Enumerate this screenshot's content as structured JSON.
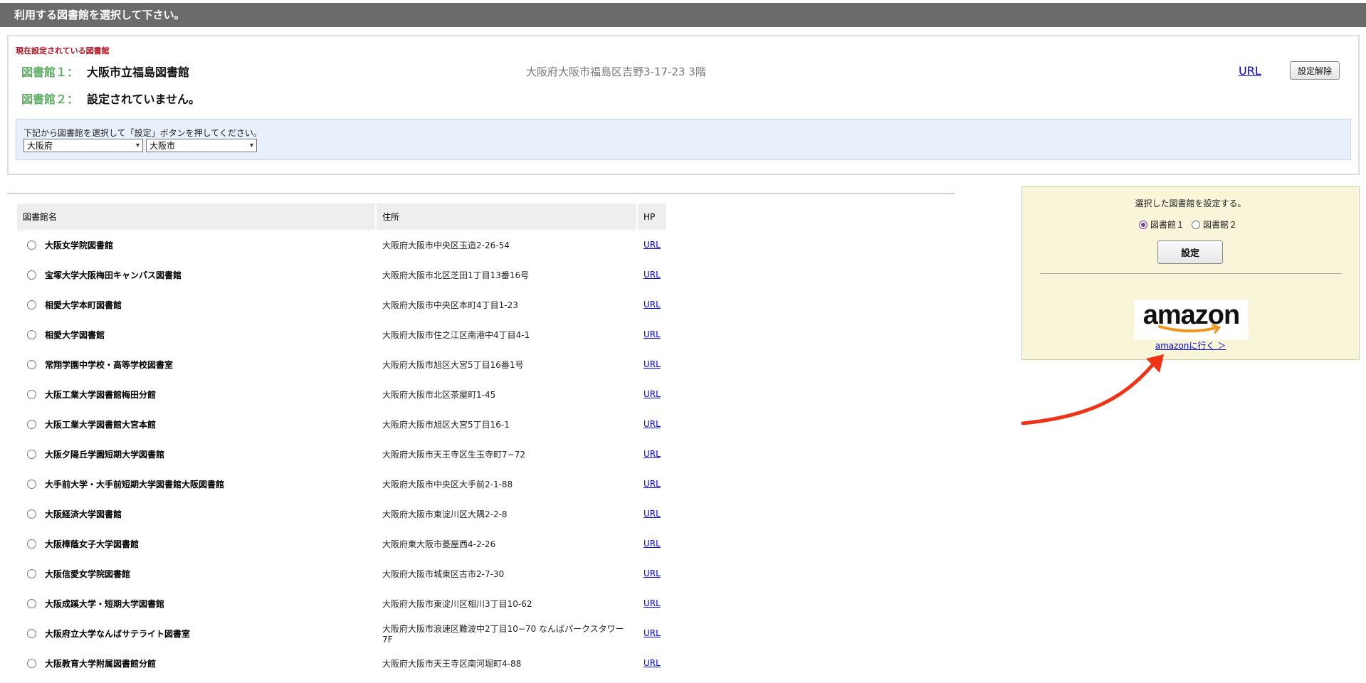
{
  "header": {
    "title": "利用する図書館を選択して下さい。"
  },
  "current": {
    "caption": "現在設定されている図書館",
    "lib1": {
      "label": "図書館１：",
      "name": "大阪市立福島図書館",
      "address": "大阪府大阪市福島区吉野3-17-23 3階",
      "url_label": "URL",
      "release_label": "設定解除"
    },
    "lib2": {
      "label": "図書館２：",
      "name": "設定されていません。"
    }
  },
  "selector": {
    "instruction": "下記から図書館を選択して「設定」ボタンを押してください。",
    "prefecture": "大阪府",
    "city": "大阪市"
  },
  "table": {
    "headers": {
      "name": "図書館名",
      "address": "住所",
      "hp": "HP"
    },
    "url_label": "URL",
    "rows": [
      {
        "name": "大阪女学院図書館",
        "address": "大阪府大阪市中央区玉造2-26-54"
      },
      {
        "name": "宝塚大学大阪梅田キャンパス図書館",
        "address": "大阪府大阪市北区芝田1丁目13番16号"
      },
      {
        "name": "相愛大学本町図書館",
        "address": "大阪府大阪市中央区本町4丁目1-23"
      },
      {
        "name": "相愛大学図書館",
        "address": "大阪府大阪市住之江区南港中4丁目4-1"
      },
      {
        "name": "常翔学園中学校・高等学校図書室",
        "address": "大阪府大阪市旭区大宮5丁目16番1号"
      },
      {
        "name": "大阪工業大学図書館梅田分館",
        "address": "大阪府大阪市北区茶屋町1-45"
      },
      {
        "name": "大阪工業大学図書館大宮本館",
        "address": "大阪府大阪市旭区大宮5丁目16-1"
      },
      {
        "name": "大阪夕陽丘学園短期大学図書館",
        "address": "大阪府大阪市天王寺区生玉寺町7−72"
      },
      {
        "name": "大手前大学・大手前短期大学図書館大阪図書館",
        "address": "大阪府大阪市中央区大手前2-1-88"
      },
      {
        "name": "大阪経済大学図書館",
        "address": "大阪府大阪市東淀川区大隅2-2-8"
      },
      {
        "name": "大阪樟蔭女子大学図書館",
        "address": "大阪府東大阪市菱屋西4-2-26"
      },
      {
        "name": "大阪信愛女学院図書館",
        "address": "大阪府大阪市城東区古市2-7-30"
      },
      {
        "name": "大阪成蹊大学・短期大学図書館",
        "address": "大阪府大阪市東淀川区相川3丁目10-62"
      },
      {
        "name": "大阪府立大学なんばサテライト図書室",
        "address": "大阪府大阪市浪速区難波中2丁目10−70 なんばパークスタワー7F"
      },
      {
        "name": "大阪教育大学附属図書館分館",
        "address": "大阪府大阪市天王寺区南河堀町4-88"
      }
    ]
  },
  "side": {
    "title": "選択した図書館を設定する。",
    "option1": "図書館１",
    "option2": "図書館２",
    "set_label": "設定",
    "amazon_logo_text": "amazon",
    "amazon_link": "amazonに行く ＞",
    "colors": {
      "panel_bg": "#f8f5d8",
      "arrow": "#ee3316",
      "amazon_smile": "#f0951d"
    }
  }
}
